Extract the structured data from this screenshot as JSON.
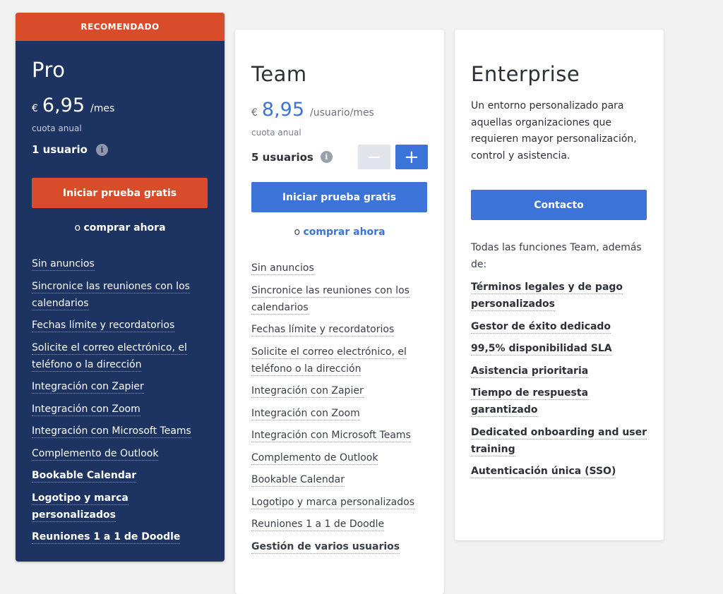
{
  "pro": {
    "badge": "RECOMENDADO",
    "name": "Pro",
    "currency": "€",
    "amount": "6,95",
    "period": "/mes",
    "billing": "cuota anual",
    "users": "1 usuario",
    "cta": "Iniciar prueba gratis",
    "buy_prefix": "o",
    "buy_link": "comprar ahora",
    "features": [
      {
        "text": "Sin anuncios"
      },
      {
        "text": "Sincronice las reuniones con los calendarios"
      },
      {
        "text": "Fechas límite y recordatorios"
      },
      {
        "text": "Solicite el correo electrónico, el teléfono o la dirección"
      },
      {
        "text": "Integración con Zapier"
      },
      {
        "text": "Integración con Zoom"
      },
      {
        "text": "Integración con Microsoft Teams"
      },
      {
        "text": "Complemento de Outlook"
      },
      {
        "text": "Bookable Calendar"
      },
      {
        "text": "Logotipo y marca personalizados"
      },
      {
        "text": "Reuniones 1 a 1 de Doodle"
      }
    ]
  },
  "team": {
    "name": "Team",
    "currency": "€",
    "amount": "8,95",
    "period": "/usuario/mes",
    "billing": "cuota anual",
    "users": "5 usuarios",
    "minus_label": "−",
    "plus_label": "+",
    "cta": "Iniciar prueba gratis",
    "buy_prefix": "o",
    "buy_link": "comprar ahora",
    "features": [
      {
        "text": "Sin anuncios"
      },
      {
        "text": "Sincronice las reuniones con los calendarios"
      },
      {
        "text": "Fechas límite y recordatorios"
      },
      {
        "text": "Solicite el correo electrónico, el teléfono o la dirección"
      },
      {
        "text": "Integración con Zapier"
      },
      {
        "text": "Integración con Zoom"
      },
      {
        "text": "Integración con Microsoft Teams"
      },
      {
        "text": "Complemento de Outlook"
      },
      {
        "text": "Bookable Calendar"
      },
      {
        "text": "Logotipo y marca personalizados"
      },
      {
        "text": "Reuniones 1 a 1 de Doodle"
      },
      {
        "text": "Gestión de varios usuarios"
      }
    ]
  },
  "enterprise": {
    "name": "Enterprise",
    "description": "Un entorno personalizado para aquellas organizaciones que requieren mayor personalización, control y asistencia.",
    "cta": "Contacto",
    "intro": "Todas las funciones Team, además de:",
    "features": [
      {
        "text": "Términos legales y de pago personalizados"
      },
      {
        "text": "Gestor de éxito dedicado"
      },
      {
        "text": "99,5% disponibilidad SLA"
      },
      {
        "text": "Asistencia prioritaria"
      },
      {
        "text": "Tiempo de respuesta garantizado"
      },
      {
        "text": "Dedicated onboarding and user training"
      },
      {
        "text": "Autenticación única (SSO)"
      }
    ]
  },
  "icons": {
    "info": "i"
  },
  "colors": {
    "pro_bg": "#1d3361",
    "accent_orange": "#d94c2a",
    "accent_blue": "#3b73d8"
  }
}
